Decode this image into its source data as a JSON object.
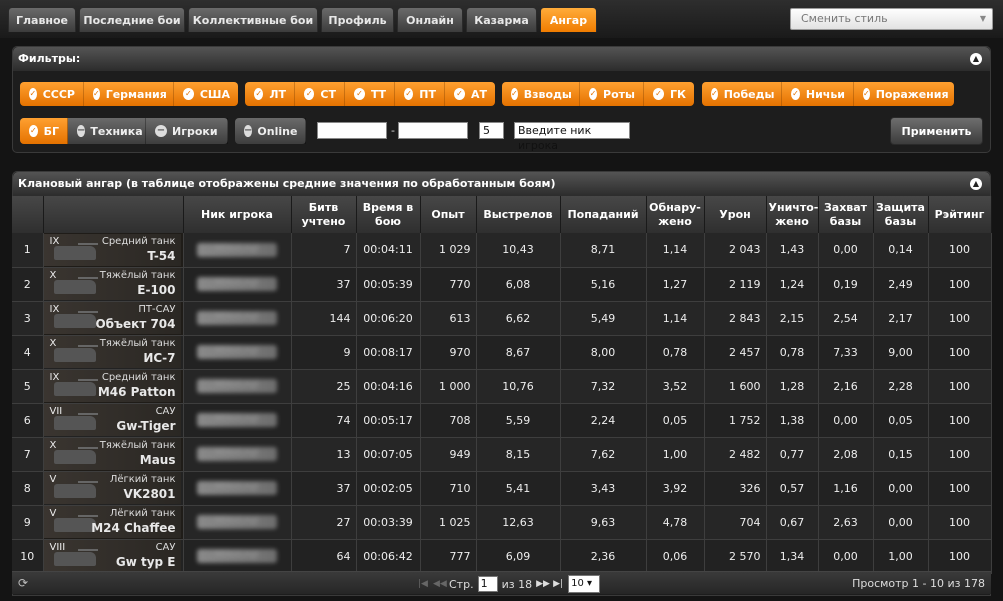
{
  "tabs": [
    {
      "label": "Главное",
      "active": false
    },
    {
      "label": "Последние бои",
      "active": false
    },
    {
      "label": "Коллективные бои",
      "active": false
    },
    {
      "label": "Профиль",
      "active": false
    },
    {
      "label": "Онлайн",
      "active": false
    },
    {
      "label": "Казарма",
      "active": false
    },
    {
      "label": "Ангар",
      "active": true
    }
  ],
  "style_select": {
    "value": "Сменить стиль"
  },
  "filters": {
    "title": "Фильтры:",
    "nations": [
      "СССР",
      "Германия",
      "США"
    ],
    "classes": [
      "ЛТ",
      "СТ",
      "ТТ",
      "ПТ",
      "АТ"
    ],
    "battle_types": [
      "Взводы",
      "Роты",
      "ГК"
    ],
    "results": [
      "Победы",
      "Ничьи",
      "Поражения"
    ],
    "view": [
      {
        "label": "БГ",
        "on": true
      },
      {
        "label": "Техника",
        "on": false
      },
      {
        "label": "Игроки",
        "on": false
      }
    ],
    "online": "Online",
    "date_from": "",
    "date_to": "",
    "date_sep": "-",
    "min_battles": "5",
    "nick_placeholder": "Введите ник игрока",
    "apply": "Применить"
  },
  "hangar": {
    "title": "Клановый ангар (в таблице отображены средние значения по обработанным боям)",
    "columns": [
      "",
      "",
      "Ник игрока",
      "Битв учтено",
      "Время в бою",
      "Опыт",
      "Выстрелов",
      "Попаданий",
      "Обнару-жено",
      "Урон",
      "Уничто-жено",
      "Захват базы",
      "Защита базы",
      "Рэйтинг"
    ],
    "rows": [
      {
        "n": "1",
        "level": "IX",
        "type": "Средний танк",
        "tank": "T-54",
        "nick": "MikoLogi",
        "battles": "7",
        "time": "00:04:11",
        "exp": "1 029",
        "shots": "10,43",
        "hits": "8,71",
        "spotted": "1,14",
        "damage": "2 043",
        "kills": "1,43",
        "capture": "0,00",
        "defense": "0,14",
        "rating": "100"
      },
      {
        "n": "2",
        "level": "X",
        "type": "Тяжёлый танк",
        "tank": "E-100",
        "nick": "MikoLogi",
        "battles": "37",
        "time": "00:05:39",
        "exp": "770",
        "shots": "6,08",
        "hits": "5,16",
        "spotted": "1,27",
        "damage": "2 119",
        "kills": "1,24",
        "capture": "0,19",
        "defense": "2,49",
        "rating": "100"
      },
      {
        "n": "3",
        "level": "IX",
        "type": "ПТ-САУ",
        "tank": "Объект 704",
        "nick": "MikoLogi",
        "battles": "144",
        "time": "00:06:20",
        "exp": "613",
        "shots": "6,62",
        "hits": "5,49",
        "spotted": "1,14",
        "damage": "2 843",
        "kills": "2,15",
        "capture": "2,54",
        "defense": "2,17",
        "rating": "100"
      },
      {
        "n": "4",
        "level": "X",
        "type": "Тяжёлый танк",
        "tank": "ИС-7",
        "nick": "MikoLogi",
        "battles": "9",
        "time": "00:08:17",
        "exp": "970",
        "shots": "8,67",
        "hits": "8,00",
        "spotted": "0,78",
        "damage": "2 457",
        "kills": "0,78",
        "capture": "7,33",
        "defense": "9,00",
        "rating": "100"
      },
      {
        "n": "5",
        "level": "IX",
        "type": "Средний танк",
        "tank": "M46 Patton",
        "nick": "MikoLogi",
        "battles": "25",
        "time": "00:04:16",
        "exp": "1 000",
        "shots": "10,76",
        "hits": "7,32",
        "spotted": "3,52",
        "damage": "1 600",
        "kills": "1,28",
        "capture": "2,16",
        "defense": "2,28",
        "rating": "100"
      },
      {
        "n": "6",
        "level": "VII",
        "type": "САУ",
        "tank": "Gw-Tiger",
        "nick": "MikoLogi",
        "battles": "74",
        "time": "00:05:17",
        "exp": "708",
        "shots": "5,59",
        "hits": "2,24",
        "spotted": "0,05",
        "damage": "1 752",
        "kills": "1,38",
        "capture": "0,00",
        "defense": "0,05",
        "rating": "100"
      },
      {
        "n": "7",
        "level": "X",
        "type": "Тяжёлый танк",
        "tank": "Maus",
        "nick": "MikoLogi",
        "battles": "13",
        "time": "00:07:05",
        "exp": "949",
        "shots": "8,15",
        "hits": "7,62",
        "spotted": "1,00",
        "damage": "2 482",
        "kills": "0,77",
        "capture": "2,08",
        "defense": "0,15",
        "rating": "100"
      },
      {
        "n": "8",
        "level": "V",
        "type": "Лёгкий танк",
        "tank": "VK2801",
        "nick": "MikoLogi",
        "battles": "37",
        "time": "00:02:05",
        "exp": "710",
        "shots": "5,41",
        "hits": "3,43",
        "spotted": "3,92",
        "damage": "326",
        "kills": "0,57",
        "capture": "1,16",
        "defense": "0,00",
        "rating": "100"
      },
      {
        "n": "9",
        "level": "V",
        "type": "Лёгкий танк",
        "tank": "M24 Chaffee",
        "nick": "MikoLogi",
        "battles": "27",
        "time": "00:03:39",
        "exp": "1 025",
        "shots": "12,63",
        "hits": "9,63",
        "spotted": "4,78",
        "damage": "704",
        "kills": "0,67",
        "capture": "2,63",
        "defense": "0,00",
        "rating": "100"
      },
      {
        "n": "10",
        "level": "VIII",
        "type": "САУ",
        "tank": "Gw typ E",
        "nick": "MikoLogi",
        "battles": "64",
        "time": "00:06:42",
        "exp": "777",
        "shots": "6,09",
        "hits": "2,36",
        "spotted": "0,06",
        "damage": "2 570",
        "kills": "1,34",
        "capture": "0,00",
        "defense": "1,00",
        "rating": "100"
      }
    ]
  },
  "pager": {
    "page_label": "Стр.",
    "page": "1",
    "of_label": "из 18",
    "per_page": "10",
    "view_text": "Просмотр 1 - 10 из 178"
  }
}
